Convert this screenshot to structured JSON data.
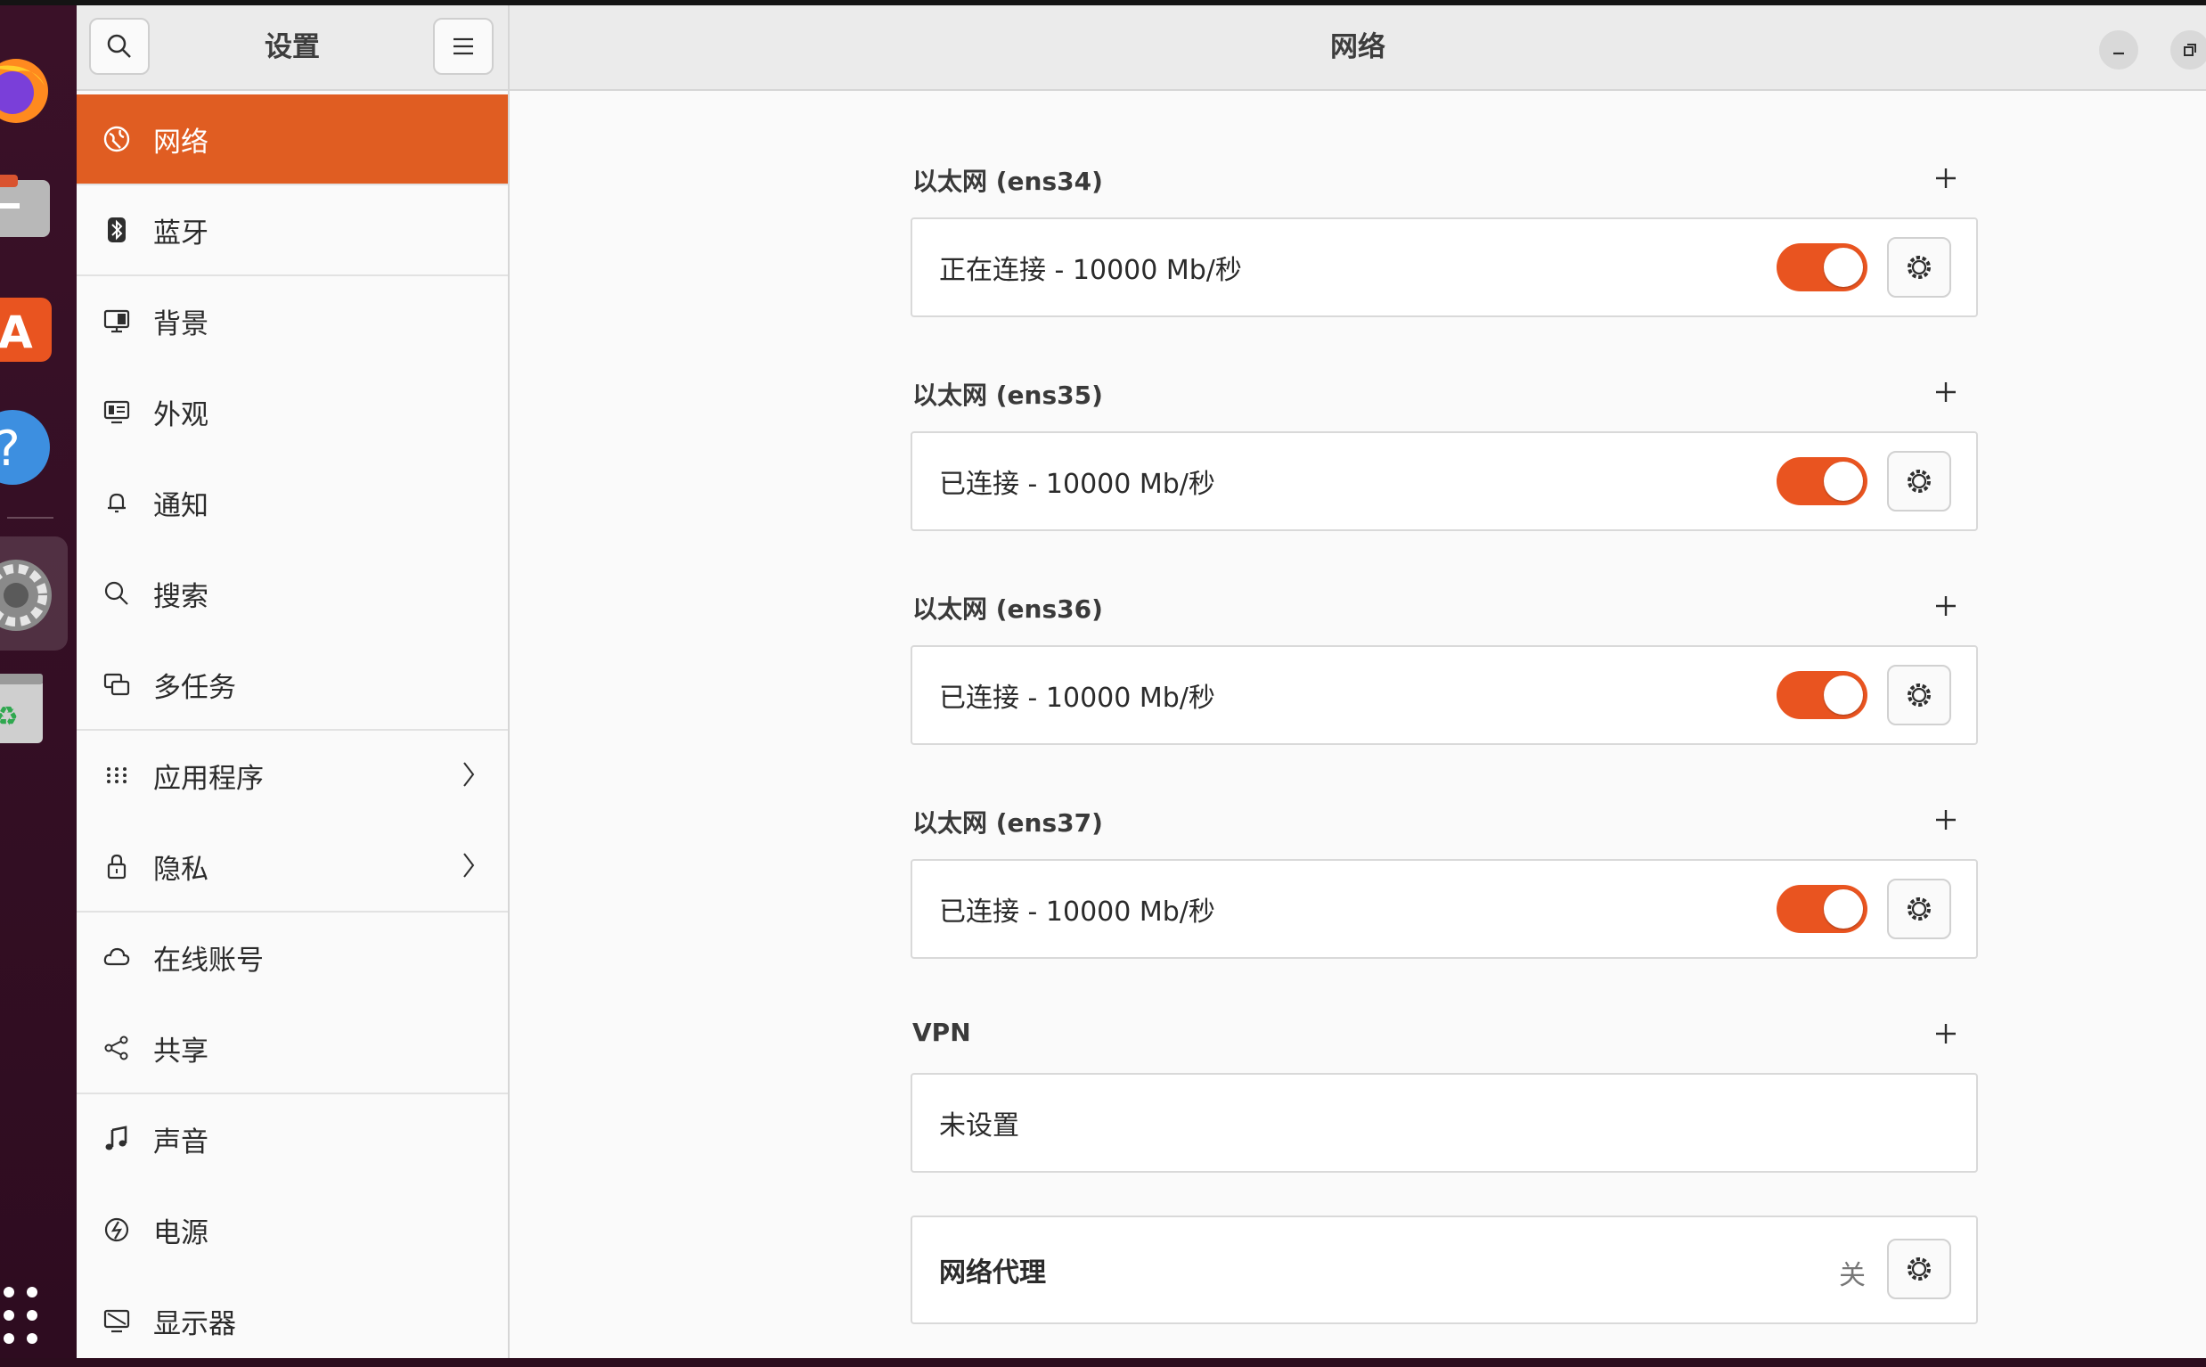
{
  "window": {
    "sidebar_title": "设置",
    "main_title": "网络"
  },
  "colors": {
    "accent": "#e95420",
    "sidebar_active": "#e05d22",
    "dock_bg": "#2e0c20"
  },
  "dock": {
    "items": [
      "firefox-icon",
      "files-icon",
      "app-center-icon",
      "help-icon",
      "settings-icon",
      "trash-icon",
      "show-apps-icon"
    ]
  },
  "sidebar": {
    "items": [
      {
        "label": "网络",
        "icon": "network-globe-icon"
      },
      {
        "label": "蓝牙",
        "icon": "bluetooth-icon"
      },
      {
        "label": "背景",
        "icon": "background-icon"
      },
      {
        "label": "外观",
        "icon": "appearance-icon"
      },
      {
        "label": "通知",
        "icon": "bell-icon"
      },
      {
        "label": "搜索",
        "icon": "search-icon"
      },
      {
        "label": "多任务",
        "icon": "multitask-icon"
      },
      {
        "label": "应用程序",
        "icon": "apps-grid-icon"
      },
      {
        "label": "隐私",
        "icon": "lock-icon"
      },
      {
        "label": "在线账号",
        "icon": "cloud-icon"
      },
      {
        "label": "共享",
        "icon": "share-icon"
      },
      {
        "label": "声音",
        "icon": "music-note-icon"
      },
      {
        "label": "电源",
        "icon": "power-icon"
      },
      {
        "label": "显示器",
        "icon": "display-icon"
      }
    ]
  },
  "main": {
    "ethernet": [
      {
        "title": "以太网 (ens34)",
        "status": "正在连接 - 10000 Mb/秒",
        "enabled": true
      },
      {
        "title": "以太网 (ens35)",
        "status": "已连接 - 10000 Mb/秒",
        "enabled": true
      },
      {
        "title": "以太网 (ens36)",
        "status": "已连接 - 10000 Mb/秒",
        "enabled": true
      },
      {
        "title": "以太网 (ens37)",
        "status": "已连接 - 10000 Mb/秒",
        "enabled": true
      }
    ],
    "vpn": {
      "title": "VPN",
      "status": "未设置"
    },
    "proxy": {
      "title": "网络代理",
      "value": "关"
    }
  }
}
